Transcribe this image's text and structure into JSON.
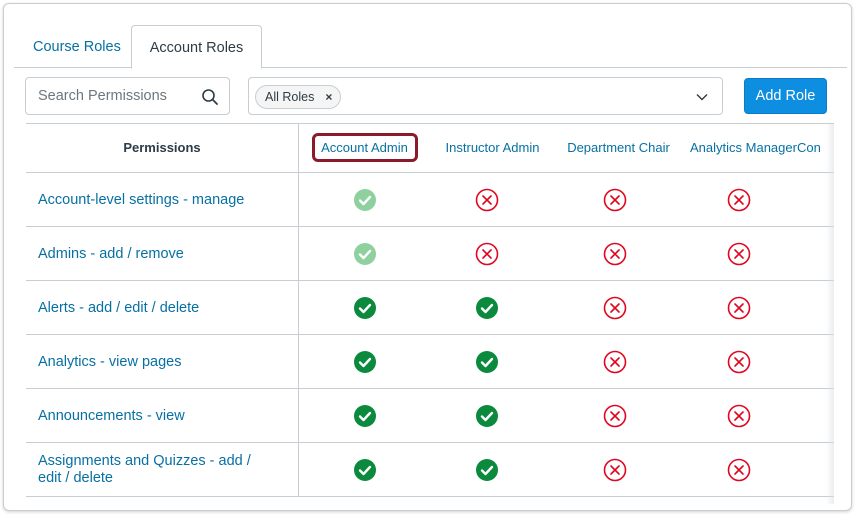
{
  "tabs": [
    {
      "label": "Course Roles"
    },
    {
      "label": "Account Roles"
    }
  ],
  "search": {
    "placeholder": "Search Permissions",
    "value": ""
  },
  "roles_filter": {
    "chip_label": "All Roles",
    "chip_remove": "×"
  },
  "add_role_label": "Add Role",
  "table": {
    "permissions_header": "Permissions",
    "roles": [
      "Account Admin",
      "Instructor Admin",
      "Department Chair",
      "Analytics Manager",
      "Con"
    ],
    "rows": [
      {
        "label": "Account-level settings - manage",
        "states": [
          "enabled-locked",
          "disabled",
          "disabled",
          "disabled"
        ]
      },
      {
        "label": "Admins - add / remove",
        "states": [
          "enabled-locked",
          "disabled",
          "disabled",
          "disabled"
        ]
      },
      {
        "label": "Alerts - add / edit / delete",
        "states": [
          "enabled",
          "enabled",
          "disabled",
          "disabled"
        ]
      },
      {
        "label": "Analytics - view pages",
        "states": [
          "enabled",
          "enabled",
          "disabled",
          "disabled"
        ]
      },
      {
        "label": "Announcements - view",
        "states": [
          "enabled",
          "enabled",
          "disabled",
          "disabled"
        ]
      },
      {
        "label": "Assignments and Quizzes - add / edit / delete",
        "states": [
          "enabled",
          "enabled",
          "disabled",
          "disabled"
        ]
      }
    ]
  },
  "colors": {
    "link": "#0770a3",
    "enabled": "#0b8a3e",
    "enabled_locked": "#8fd19e",
    "disabled": "#e0061f",
    "highlight_box": "#8b1a2a",
    "button": "#0e8ee0"
  },
  "icons": {
    "search": "search-icon",
    "chevron": "chevron-down-icon",
    "enabled": "check-circle-icon",
    "disabled": "x-circle-icon"
  }
}
